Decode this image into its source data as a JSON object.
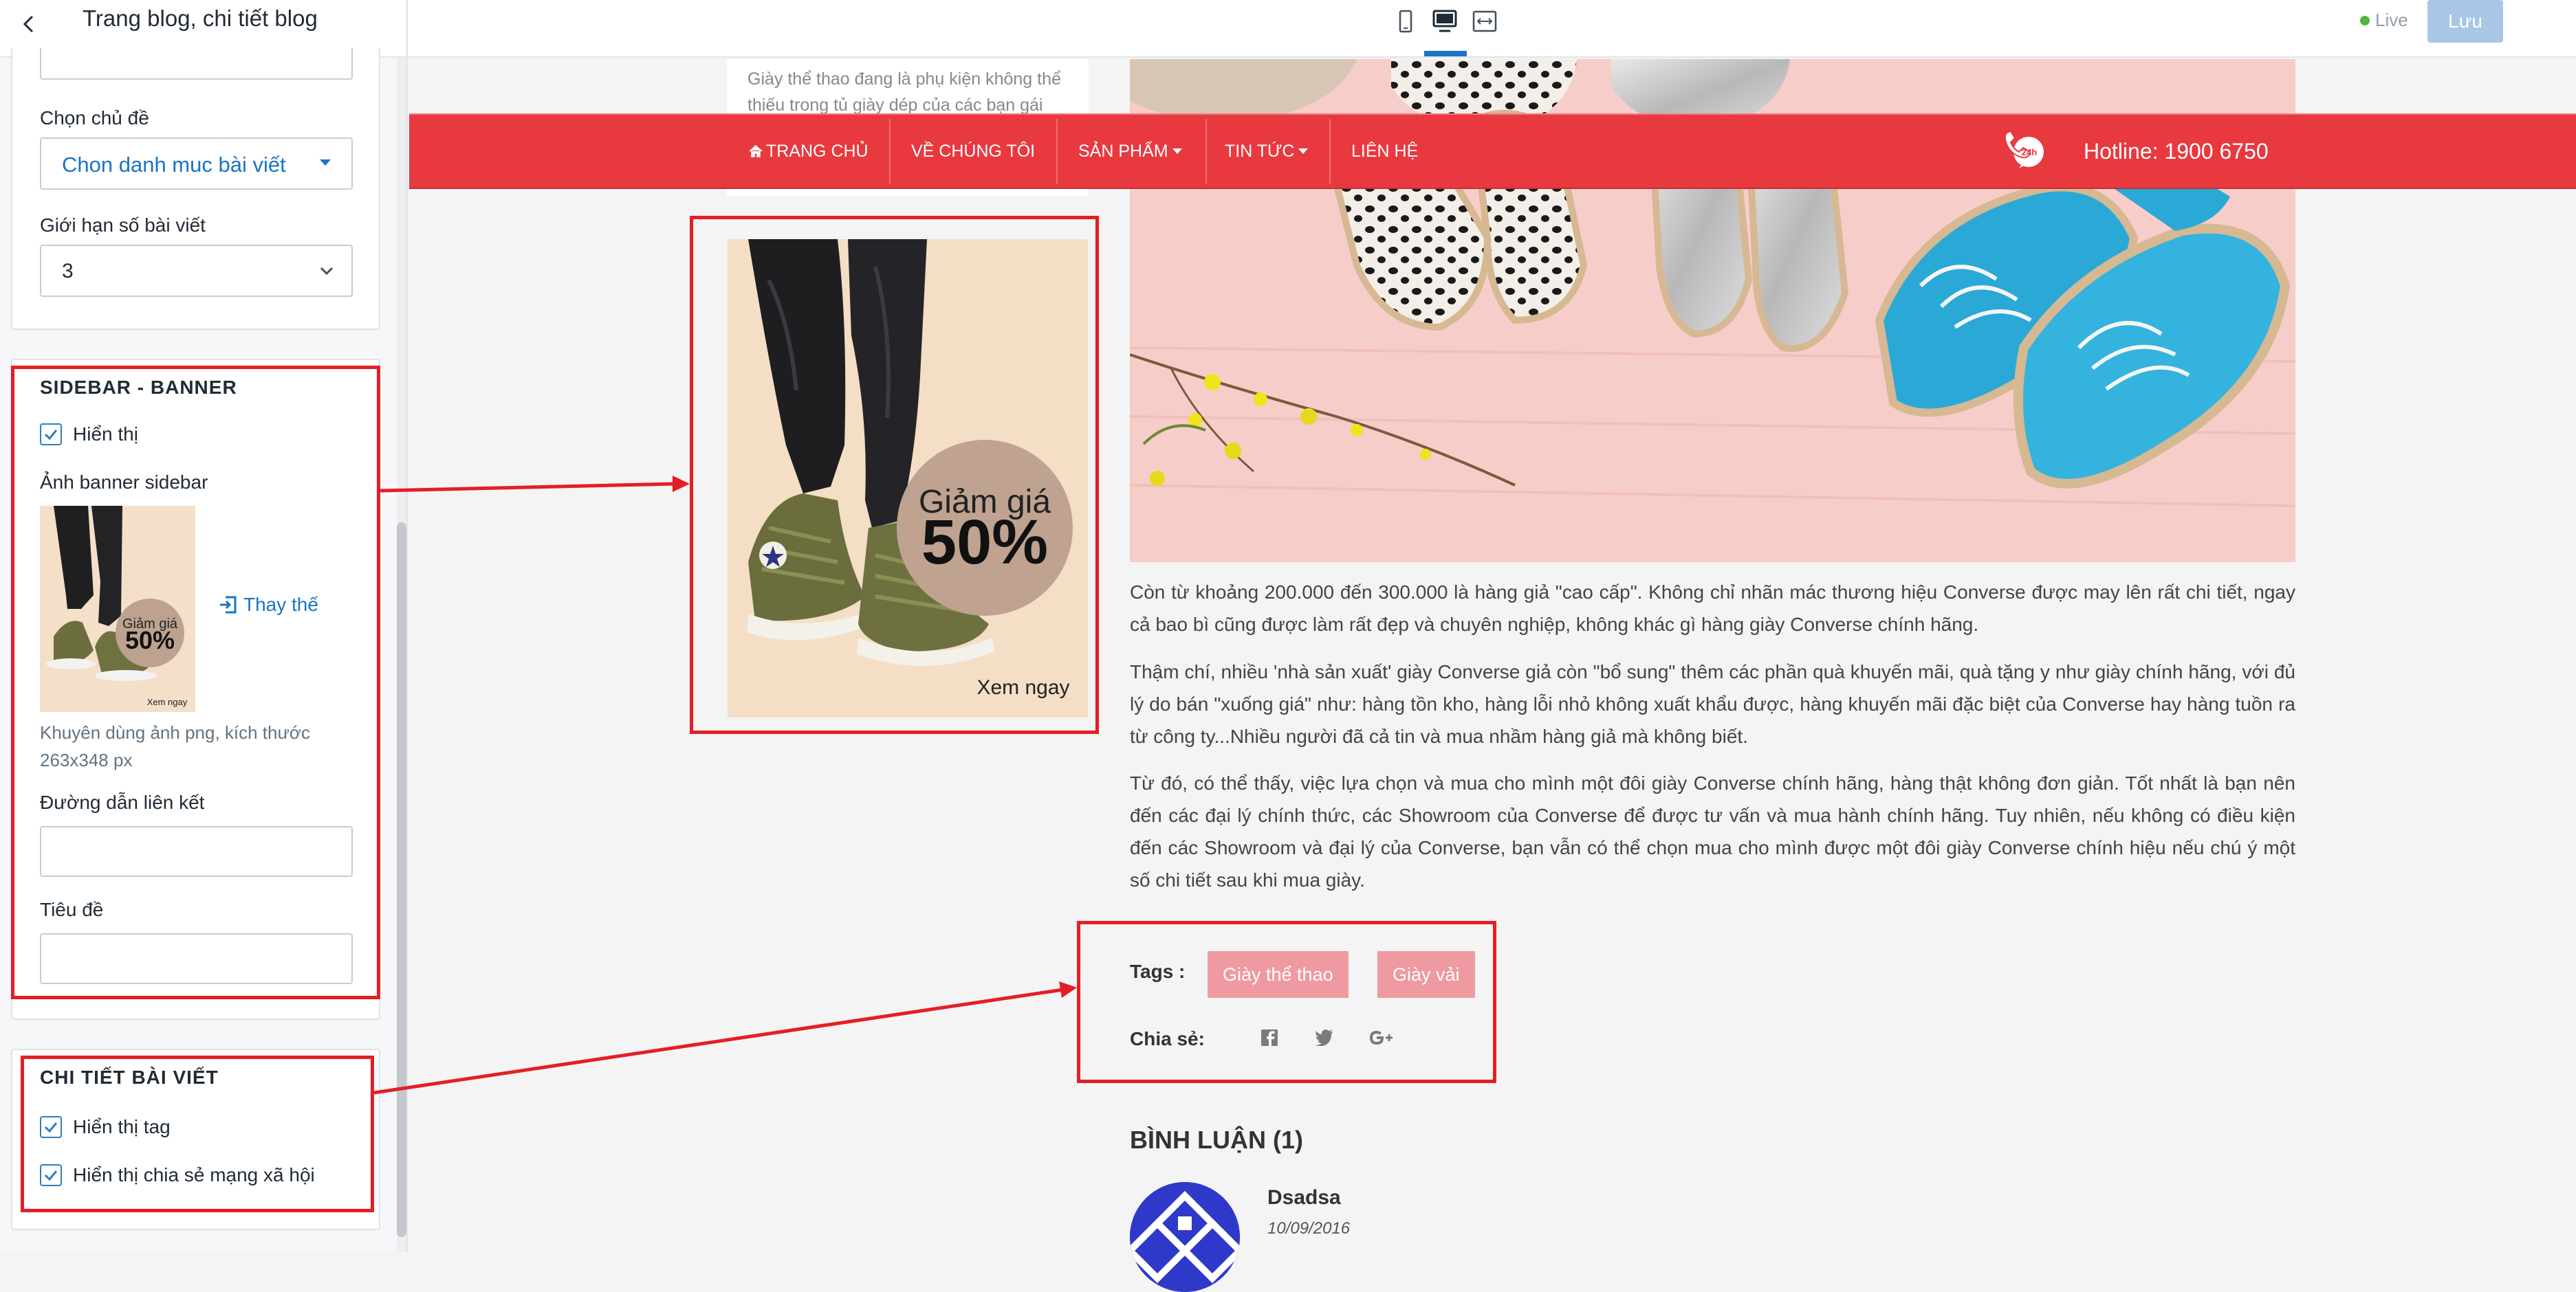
{
  "sidebar": {
    "title": "Trang blog, chi tiết blog",
    "category_label": "Chọn chủ đề",
    "category_value": "Chon danh muc bài viết",
    "limit_label": "Giới hạn số bài viết",
    "limit_value": "3",
    "banner_section": {
      "title": "SIDEBAR - BANNER",
      "show_label": "Hiển thị",
      "show_checked": true,
      "image_label": "Ảnh banner sidebar",
      "replace_label": "Thay thế",
      "help": "Khuyên dùng ảnh png, kích thước 263x348 px",
      "link_label": "Đường dẫn liên kết",
      "link_value": "",
      "heading_label": "Tiêu đề",
      "heading_value": ""
    },
    "detail_section": {
      "title": "CHI TIẾT BÀI VIẾT",
      "show_tags_label": "Hiển thị tag",
      "show_tags_checked": true,
      "show_share_label": "Hiển thị chia sẻ mạng xã hội",
      "show_share_checked": true
    }
  },
  "banner": {
    "discount_line1": "Giảm giá",
    "discount_line2": "50%",
    "cta": "Xem ngay"
  },
  "toolbar": {
    "devices": [
      "mobile-icon",
      "desktop-icon",
      "fullwidth-icon"
    ],
    "active_device": "desktop-icon",
    "live_label": "Live",
    "save_label": "Lưu"
  },
  "nav": {
    "items": [
      "TRANG CHỦ",
      "VỀ CHÚNG TÔI",
      "SẢN PHẨM",
      "TIN TỨC",
      "LIÊN HỆ"
    ],
    "hotline": "Hotline: 1900 6750",
    "hotline_badge": "24h"
  },
  "intro_text": "Giày thể thao đang là phụ kiện không thể thiếu trong tủ giày dép của các bạn gái",
  "article": {
    "p1": "Còn từ khoảng 200.000 đến 300.000 là hàng giả \"cao cấp\". Không chỉ nhãn mác thương hiệu Converse được may lên rất chi tiết, ngay cả bao bì cũng được làm rất đẹp và chuyên nghiệp, không khác gì hàng giày Converse chính hãng.",
    "p2": "Thậm chí, nhiều 'nhà sản xuất' giày Converse giả còn \"bổ sung\" thêm các phần quà khuyến mãi, quà tặng y như giày chính hãng, với đủ lý do bán \"xuống giá\" như: hàng tồn kho, hàng lỗi nhỏ không xuất khẩu được, hàng khuyến mãi đặc biệt của Converse hay hàng tuồn ra từ công ty...Nhiều người đã cả tin và mua nhầm hàng giả mà không biết.",
    "p3": "Từ đó, có thể thấy, việc lựa chọn và mua cho mình một đôi giày Converse chính hãng, hàng thật không đơn giản. Tốt nhất là bạn nên đến các đại lý chính thức, các Showroom của Converse để được tư vấn và mua hành chính hãng. Tuy nhiên, nếu không có điều kiện đến các Showroom và đại lý của Converse, bạn vẫn có thể chọn mua cho mình được một đôi giày Converse chính hiệu nếu chú ý một số chi tiết sau khi mua giày."
  },
  "tags": {
    "label": "Tags :",
    "items": [
      "Giày thể thao",
      "Giày vải"
    ]
  },
  "share": {
    "label": "Chia sẻ:",
    "icons": [
      "facebook-icon",
      "twitter-icon",
      "google-plus-icon"
    ]
  },
  "comments": {
    "title": "BÌNH LUẬN (1)",
    "items": [
      {
        "name": "Dsadsa",
        "date": "10/09/2016"
      }
    ]
  },
  "colors": {
    "nav_red": "#e8393f",
    "tag_pink": "#ef9aa0",
    "accent_blue": "#1a74c4",
    "annotation_red": "#e41e26"
  }
}
